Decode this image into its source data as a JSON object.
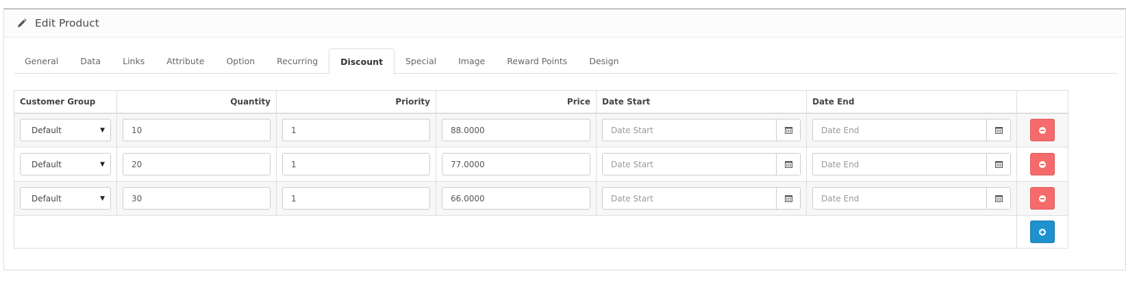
{
  "header": {
    "title": "Edit Product",
    "icon": "pencil-icon"
  },
  "tabs": [
    {
      "label": "General",
      "active": false
    },
    {
      "label": "Data",
      "active": false
    },
    {
      "label": "Links",
      "active": false
    },
    {
      "label": "Attribute",
      "active": false
    },
    {
      "label": "Option",
      "active": false
    },
    {
      "label": "Recurring",
      "active": false
    },
    {
      "label": "Discount",
      "active": true
    },
    {
      "label": "Special",
      "active": false
    },
    {
      "label": "Image",
      "active": false
    },
    {
      "label": "Reward Points",
      "active": false
    },
    {
      "label": "Design",
      "active": false
    }
  ],
  "table": {
    "headers": {
      "customer_group": "Customer Group",
      "quantity": "Quantity",
      "priority": "Priority",
      "price": "Price",
      "date_start": "Date Start",
      "date_end": "Date End"
    },
    "rows": [
      {
        "customer_group": "Default",
        "quantity": "10",
        "priority": "1",
        "price": "88.0000",
        "date_start_placeholder": "Date Start",
        "date_end_placeholder": "Date End"
      },
      {
        "customer_group": "Default",
        "quantity": "20",
        "priority": "1",
        "price": "77.0000",
        "date_start_placeholder": "Date Start",
        "date_end_placeholder": "Date End"
      },
      {
        "customer_group": "Default",
        "quantity": "30",
        "priority": "1",
        "price": "66.0000",
        "date_start_placeholder": "Date Start",
        "date_end_placeholder": "Date End"
      }
    ]
  },
  "colors": {
    "remove_button": "#f56b6b",
    "add_button": "#1e91cf"
  }
}
